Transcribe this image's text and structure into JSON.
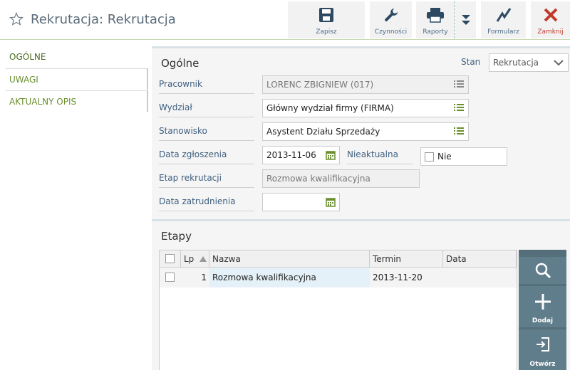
{
  "header": {
    "title": "Rekrutacja: Rekrutacja",
    "toolbar": [
      {
        "id": "zapisz",
        "label": "Zapisz",
        "icon": "save-icon"
      },
      {
        "id": "czynnosci",
        "label": "Czynności",
        "icon": "wrench-icon"
      },
      {
        "id": "raporty",
        "label": "Raporty",
        "icon": "printer-icon"
      },
      {
        "id": "formularz",
        "label": "Formularz",
        "icon": "chart-icon"
      },
      {
        "id": "zamknij",
        "label": "Zamknij",
        "icon": "close-icon"
      }
    ],
    "colors": {
      "accent": "#6a8f2d",
      "close": "#c0392b",
      "label_blue": "#3f5f7f"
    }
  },
  "nav": {
    "items": [
      {
        "label": "OGÓLNE"
      },
      {
        "label": "UWAGI"
      },
      {
        "label": "AKTUALNY OPIS"
      }
    ]
  },
  "general": {
    "title": "Ogólne",
    "stan_label": "Stan",
    "stan_value": "Rekrutacja",
    "fields": {
      "pracownik": {
        "label": "Pracownik",
        "value": "LORENC ZBIGNIEW (017)"
      },
      "wydzial": {
        "label": "Wydział",
        "value": "Główny wydział firmy (FIRMA)"
      },
      "stanowisko": {
        "label": "Stanowisko",
        "value": "Asystent Działu Sprzedaży"
      },
      "data_zgloszenia": {
        "label": "Data zgłoszenia",
        "value": "2013-11-06"
      },
      "nieaktualna": {
        "label": "Nieaktualna",
        "value": "Nie"
      },
      "etap": {
        "label": "Etap rekrutacji",
        "value": "Rozmowa kwalifikacyjna"
      },
      "data_zatrudnienia": {
        "label": "Data zatrudnienia",
        "value": ""
      }
    }
  },
  "etapy": {
    "title": "Etapy",
    "columns": {
      "lp": "Lp",
      "nazwa": "Nazwa",
      "termin": "Termin",
      "data": "Data"
    },
    "rows": [
      {
        "lp": "1",
        "nazwa": "Rozmowa kwalifikacyjna",
        "termin": "2013-11-20",
        "data": ""
      }
    ],
    "actions": {
      "dodaj": "Dodaj",
      "otworz": "Otwórz"
    }
  }
}
